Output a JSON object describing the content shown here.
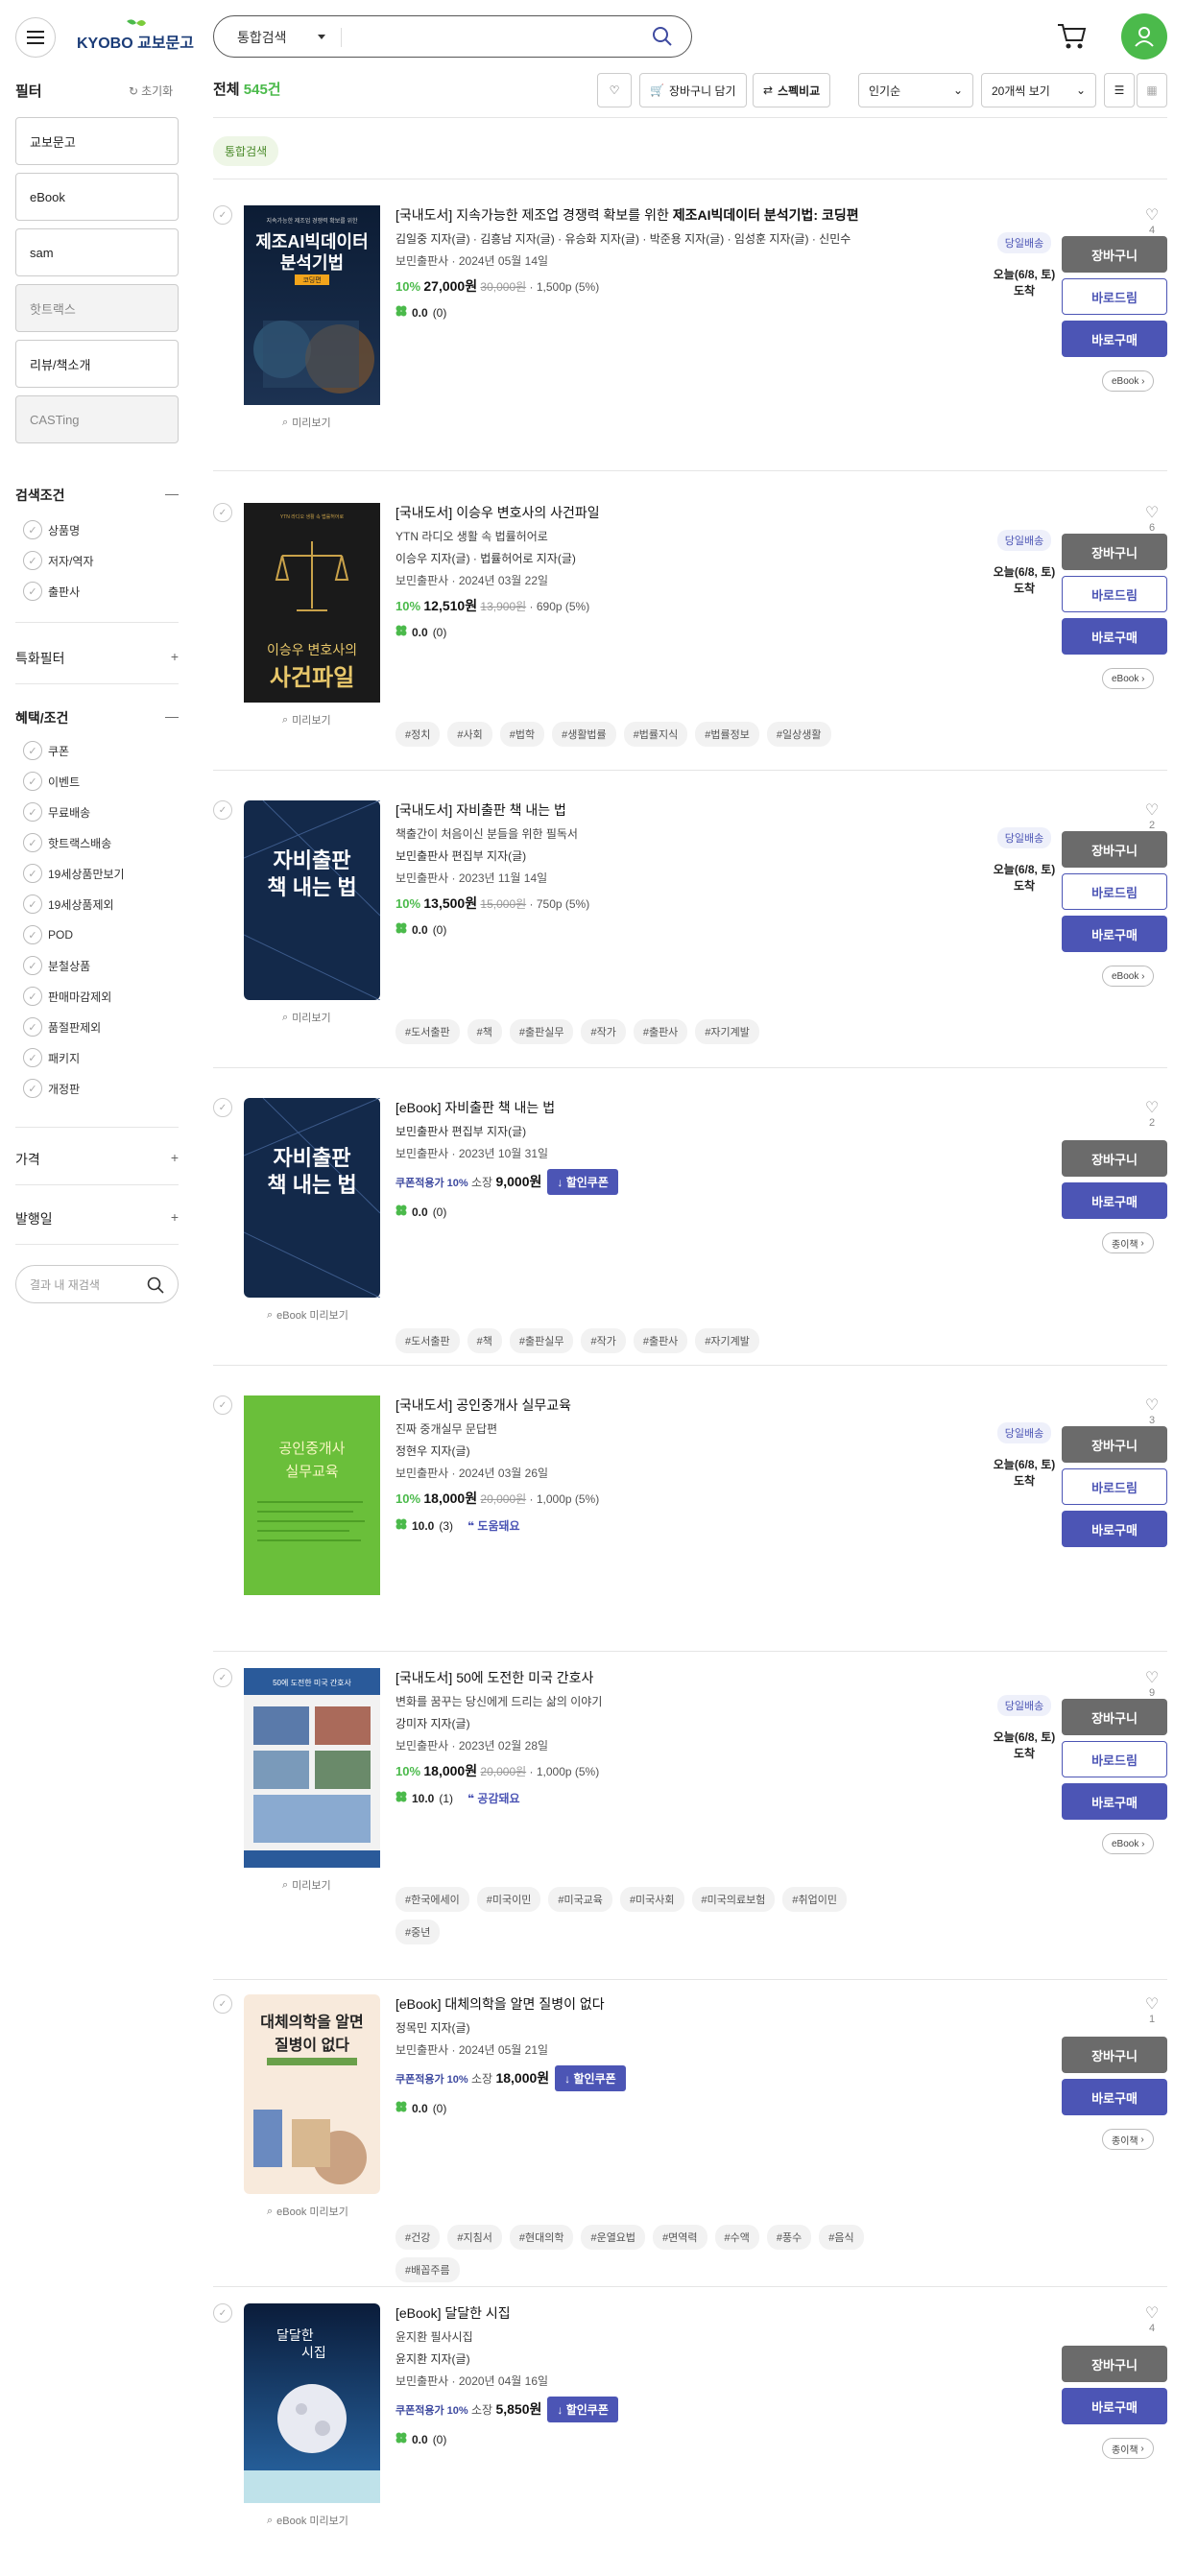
{
  "header": {
    "logo_text": "KYOBO 교보문고",
    "search_scope": "통합검색",
    "search_placeholder": ""
  },
  "sidebar": {
    "title": "필터",
    "reset": "초기화",
    "buttons": [
      "교보문고",
      "eBook",
      "sam",
      "핫트랙스",
      "리뷰/책소개",
      "CASTing"
    ],
    "search_cond_title": "검색조건",
    "search_cond_items": [
      "상품명",
      "저자/역자",
      "출판사"
    ],
    "special_filter": "특화필터",
    "benefit_title": "혜택/조건",
    "benefit_items": [
      "쿠폰",
      "이벤트",
      "무료배송",
      "핫트랙스배송",
      "19세상품만보기",
      "19세상품제외",
      "POD",
      "분철상품",
      "판매마감제외",
      "품절판제외",
      "패키지",
      "개정판"
    ],
    "price": "가격",
    "pubdate": "발행일",
    "in_search_placeholder": "결과 내 재검색"
  },
  "toolbar": {
    "total_label": "전체",
    "total_count": "545건",
    "cart_label": "장바구니 담기",
    "spec_label": "스펙비교",
    "sort": "인기순",
    "per_page": "20개씩 보기",
    "tag": "통합검색"
  },
  "items": [
    {
      "title_pre": "[국내도서]",
      "title_a": "지속가능한 제조업 경쟁력 확보를 위한 ",
      "title_b": "제조AI빅데이터 분석기법: 코딩편",
      "authors": "김일중 지자(글) · 김흥남 지자(글) · 유승화 지자(글) · 박준용 지자(글) · 임성훈 지자(글) · 신민수",
      "publisher": "보민출판사 · 2024년 05월 14일",
      "pct": "10%",
      "price": "27,000원",
      "orig": "30,000원",
      "points": "1,500p (5%)",
      "score": "0.0",
      "count": "(0)",
      "deliv_badge": "당일배송",
      "deliv_date": "오늘(6/8, 토)",
      "deliv_text": "도착",
      "likes": "4",
      "format": "eBook",
      "preview": "미리보기",
      "cart": "장바구니",
      "gift": "바로드림",
      "buy": "바로구매"
    },
    {
      "title_pre": "[국내도서]",
      "title_a": "이승우 변호사의 사건파일",
      "title_b": "",
      "subtitle": "YTN 라디오 생활 속 법률허어로",
      "authors": "이승우 지자(글) · 법률허어로 지자(글)",
      "publisher": "보민출판사 · 2024년 03월 22일",
      "pct": "10%",
      "price": "12,510원",
      "orig": "13,900원",
      "points": "690p (5%)",
      "score": "0.0",
      "count": "(0)",
      "deliv_badge": "당일배송",
      "deliv_date": "오늘(6/8, 토)",
      "deliv_text": "도착",
      "likes": "6",
      "format": "eBook",
      "preview": "미리보기",
      "tags": [
        "#정치",
        "#사회",
        "#법학",
        "#생활법률",
        "#법률지식",
        "#법률정보",
        "#일상생활"
      ]
    },
    {
      "title_pre": "[국내도서]",
      "title_a": "자비출판 책 내는 법",
      "title_b": "",
      "subtitle": "책출간이 처음이신 분들을 위한 필독서",
      "authors": "보민출판사 편집부 지자(글)",
      "publisher": "보민출판사 · 2023년 11월 14일",
      "pct": "10%",
      "price": "13,500원",
      "orig": "15,000원",
      "points": "750p (5%)",
      "score": "0.0",
      "count": "(0)",
      "deliv_badge": "당일배송",
      "deliv_date": "오늘(6/8, 토)",
      "deliv_text": "도착",
      "likes": "2",
      "format": "eBook",
      "preview": "미리보기",
      "tags": [
        "#도서출판",
        "#책",
        "#출판실무",
        "#작가",
        "#출판사",
        "#자기계발"
      ]
    },
    {
      "title_pre": "[eBook]",
      "title_a": "자비출판 책 내는 법",
      "title_b": "",
      "authors": "보민출판사 편집부 지자(글)",
      "publisher": "보민출판사 · 2023년 10월 31일",
      "coupon": "쿠폰적용가 10%",
      "coupon_pre": "소장",
      "price": "9,000원",
      "coupon_btn": "할인쿠폰",
      "score": "0.0",
      "count": "(0)",
      "likes": "2",
      "format": "종이책",
      "preview": "eBook 미리보기",
      "tags": [
        "#도서출판",
        "#책",
        "#출판실무",
        "#작가",
        "#출판사",
        "#자기계발"
      ]
    },
    {
      "title_pre": "[국내도서]",
      "title_a": "공인중개사 실무교육",
      "title_b": "",
      "subtitle": "진짜 중개실무 문답편",
      "authors": "정현우 지자(글)",
      "publisher": "보민출판사 · 2024년 03월 26일",
      "pct": "10%",
      "price": "18,000원",
      "orig": "20,000원",
      "points": "1,000p (5%)",
      "score": "10.0",
      "count": "(3)",
      "review": "도움돼요",
      "deliv_badge": "당일배송",
      "deliv_date": "오늘(6/8, 토)",
      "deliv_text": "도착",
      "likes": "3"
    },
    {
      "title_pre": "[국내도서]",
      "title_a": "50에 도전한 미국 간호사",
      "title_b": "",
      "subtitle": "변화를 꿈꾸는 당신에게 드리는 삶의 이야기",
      "authors": "강미자 지자(글)",
      "publisher": "보민출판사 · 2023년 02월 28일",
      "pct": "10%",
      "price": "18,000원",
      "orig": "20,000원",
      "points": "1,000p (5%)",
      "score": "10.0",
      "count": "(1)",
      "review": "공감돼요",
      "deliv_badge": "당일배송",
      "deliv_date": "오늘(6/8, 토)",
      "deliv_text": "도착",
      "likes": "9",
      "format": "eBook",
      "preview": "미리보기",
      "tags": [
        "#한국에세이",
        "#미국이민",
        "#미국교육",
        "#미국사회",
        "#미국의료보험",
        "#취업이민",
        "#중년"
      ]
    },
    {
      "title_pre": "[eBook]",
      "title_a": "대체의학을 알면 질병이 없다",
      "title_b": "",
      "authors": "정목민 지자(글)",
      "publisher": "보민출판사 · 2024년 05월 21일",
      "coupon": "쿠폰적용가 10%",
      "coupon_pre": "소장",
      "price": "18,000원",
      "coupon_btn": "할인쿠폰",
      "score": "0.0",
      "count": "(0)",
      "likes": "1",
      "format": "종이책",
      "preview": "eBook 미리보기",
      "tags": [
        "#건강",
        "#지침서",
        "#현대의학",
        "#운열요법",
        "#면역력",
        "#수액",
        "#풍수",
        "#음식",
        "#배꼽주름"
      ]
    },
    {
      "title_pre": "[eBook]",
      "title_a": "달달한 시집",
      "title_b": "",
      "subtitle": "윤지환 필사시집",
      "authors": "윤지환 지자(글)",
      "publisher": "보민출판사 · 2020년 04월 16일",
      "coupon": "쿠폰적용가 10%",
      "coupon_pre": "소장",
      "price": "5,850원",
      "coupon_btn": "할인쿠폰",
      "score": "0.0",
      "count": "(0)",
      "likes": "4",
      "format": "종이책",
      "preview": "eBook 미리보기"
    }
  ],
  "covers": {
    "c1_top": "지속가능한 제조업 경쟁력 확보를 위한",
    "c1_main1": "제조AI빅데이터",
    "c1_main2": "분석기법",
    "c1_tag": "코딩편",
    "c2_top": "YTN 라디오 생활 속 법률허어로",
    "c2_main1": "이승우 변호사의",
    "c2_main2": "사건파일",
    "c3_main1": "자비출판",
    "c3_main2": "책 내는 법",
    "c5_main1": "공인중개사",
    "c5_main2": "실무교육",
    "c6_top": "50에 도전한 미국 간호사",
    "c7_main1": "대체의학을 알면",
    "c7_main2": "질병이 없다",
    "c8_main1": "달달한",
    "c8_main2": "시집"
  },
  "common": {
    "cart": "장바구니",
    "gift": "바로드림",
    "buy": "바로구매",
    "dl": "↓"
  }
}
